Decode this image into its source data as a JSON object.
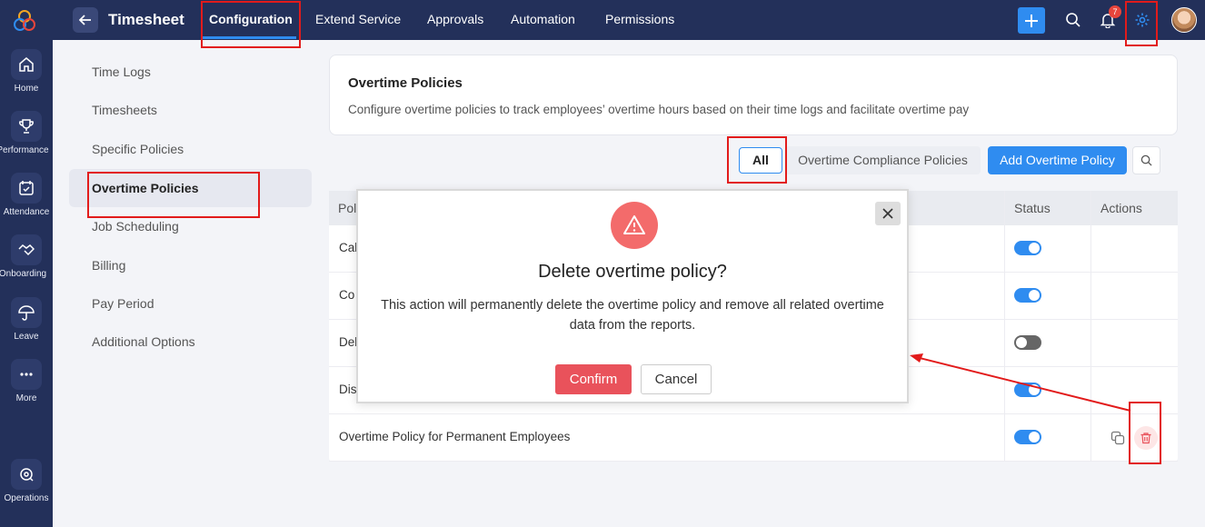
{
  "rail": {
    "items": [
      {
        "label": "Home",
        "icon": "home-icon"
      },
      {
        "label": "Performance",
        "icon": "trophy-icon"
      },
      {
        "label": "Attendance",
        "icon": "calendar-check-icon"
      },
      {
        "label": "Onboarding",
        "icon": "handshake-icon"
      },
      {
        "label": "Leave",
        "icon": "umbrella-icon"
      },
      {
        "label": "More",
        "icon": "more-dots-icon"
      },
      {
        "label": "Operations",
        "icon": "operations-icon"
      }
    ]
  },
  "topbar": {
    "title": "Timesheet",
    "nav": [
      "Configuration",
      "Extend Service",
      "Approvals",
      "Automation",
      "Permissions"
    ],
    "active_nav": "Configuration",
    "notification_count": "7"
  },
  "sidebar": {
    "items": [
      "Time Logs",
      "Timesheets",
      "Specific Policies",
      "Overtime Policies",
      "Job Scheduling",
      "Billing",
      "Pay Period",
      "Additional Options"
    ],
    "active": "Overtime Policies"
  },
  "header_card": {
    "title": "Overtime Policies",
    "description": "Configure overtime policies to track employees’ overtime hours based on their time logs and facilitate overtime pay"
  },
  "filters": {
    "all": "All",
    "compliance": "Overtime Compliance Policies",
    "add_button": "Add Overtime Policy"
  },
  "table": {
    "columns": [
      "Pol",
      "Status",
      "Actions"
    ],
    "rows": [
      {
        "name": "Cal",
        "status": "on"
      },
      {
        "name": "Co",
        "status": "on"
      },
      {
        "name": "Del",
        "status": "off"
      },
      {
        "name": "Dis",
        "status": "on"
      },
      {
        "name": "Overtime Policy for Permanent Employees",
        "status": "on"
      }
    ]
  },
  "modal": {
    "title": "Delete overtime policy?",
    "message": "This action will permanently delete the overtime policy and remove all related overtime data from the reports.",
    "confirm": "Confirm",
    "cancel": "Cancel"
  },
  "colors": {
    "navy": "#23305a",
    "accent": "#2f8cf0",
    "danger": "#e9525b",
    "highlight": "#e21b1b"
  }
}
